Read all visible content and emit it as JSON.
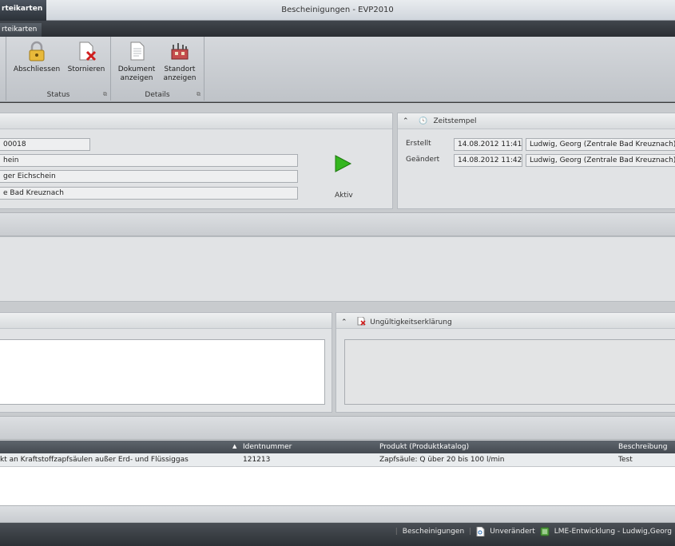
{
  "titlebar": {
    "context_tab": "rteikarten",
    "window_title": "Bescheinigungen - EVP2010"
  },
  "tabstrip": {
    "active_tab": "rteikarten"
  },
  "ribbon": {
    "groups": [
      {
        "label": "Status",
        "buttons": [
          {
            "label": "Abschliessen",
            "icon": "lock-icon"
          },
          {
            "label": "Stornieren",
            "icon": "cancel-document-icon"
          }
        ]
      },
      {
        "label": "Details",
        "buttons": [
          {
            "label": "Dokument\nanzeigen",
            "icon": "document-icon"
          },
          {
            "label": "Standort\nanzeigen",
            "icon": "location-icon"
          }
        ]
      }
    ]
  },
  "main": {
    "fields": [
      "00018",
      "hein",
      "ger Eichschein",
      "e Bad Kreuznach"
    ],
    "status_label": "Aktiv"
  },
  "zeitstempel": {
    "title": "Zeitstempel",
    "rows": [
      {
        "label": "Erstellt",
        "date": "14.08.2012 11:41",
        "user": "Ludwig, Georg (Zentrale Bad Kreuznach)"
      },
      {
        "label": "Geändert",
        "date": "14.08.2012 11:42",
        "user": "Ludwig, Georg (Zentrale Bad Kreuznach)"
      }
    ]
  },
  "ungueltigkeit": {
    "title": "Ungültigkeitserklärung"
  },
  "grid": {
    "columns": [
      "",
      "Identnummer",
      "Produkt (Produktkatalog)",
      "Beschreibung"
    ],
    "rows": [
      [
        "kt an Kraftstoffzapfsäulen außer Erd- und Flüssiggas",
        "121213",
        "Zapfsäule: Q über 20 bis 100 l/min",
        "Test"
      ]
    ]
  },
  "statusbar": {
    "module": "Bescheinigungen",
    "state": "Unverändert",
    "user": "LME-Entwicklung - Ludwig,Georg"
  },
  "colors": {
    "accent_green": "#34b61e",
    "header_dark": "#444a51"
  }
}
